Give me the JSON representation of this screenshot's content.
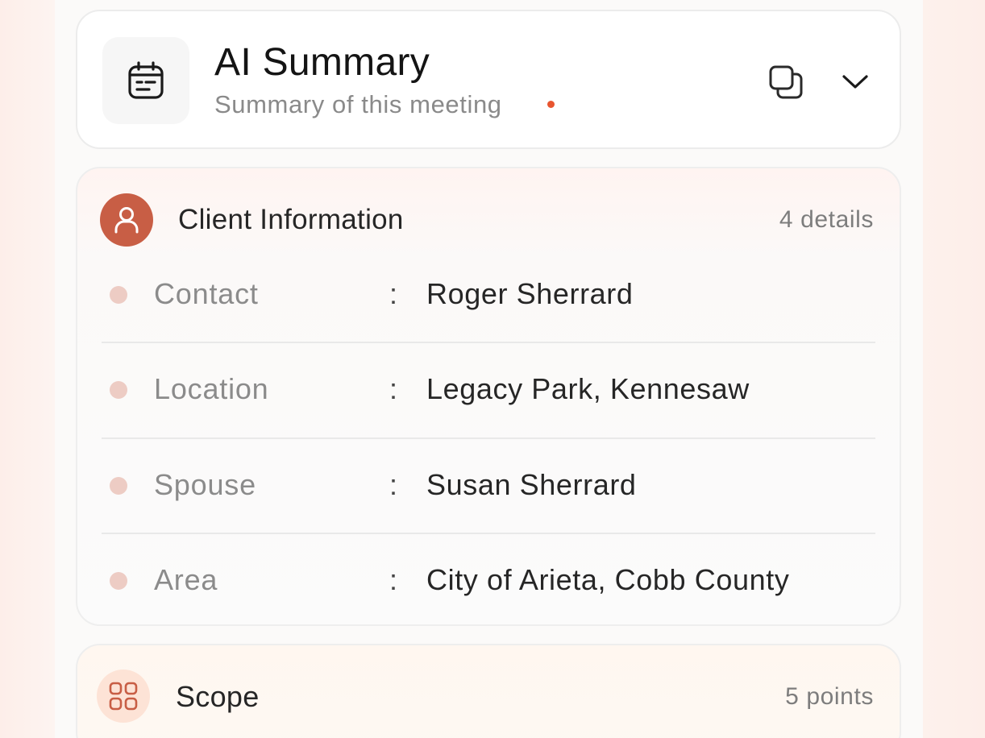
{
  "header": {
    "title": "AI Summary",
    "subtitle": "Summary of this meeting",
    "icon": "calendar-notes-icon",
    "status_color": "#e8552f"
  },
  "client_info": {
    "title": "Client Information",
    "count": "4 details",
    "icon": "user-icon",
    "accent_color": "#c85e45",
    "rows": [
      {
        "label": "Contact",
        "separator": ":",
        "value": "Roger Sherrard"
      },
      {
        "label": "Location",
        "separator": ":",
        "value": "Legacy Park, Kennesaw"
      },
      {
        "label": "Spouse",
        "separator": ":",
        "value": "Susan Sherrard"
      },
      {
        "label": "Area",
        "separator": ":",
        "value": "City of Arieta, Cobb County"
      }
    ]
  },
  "scope": {
    "title": "Scope",
    "count": "5 points",
    "icon": "grid-icon"
  }
}
